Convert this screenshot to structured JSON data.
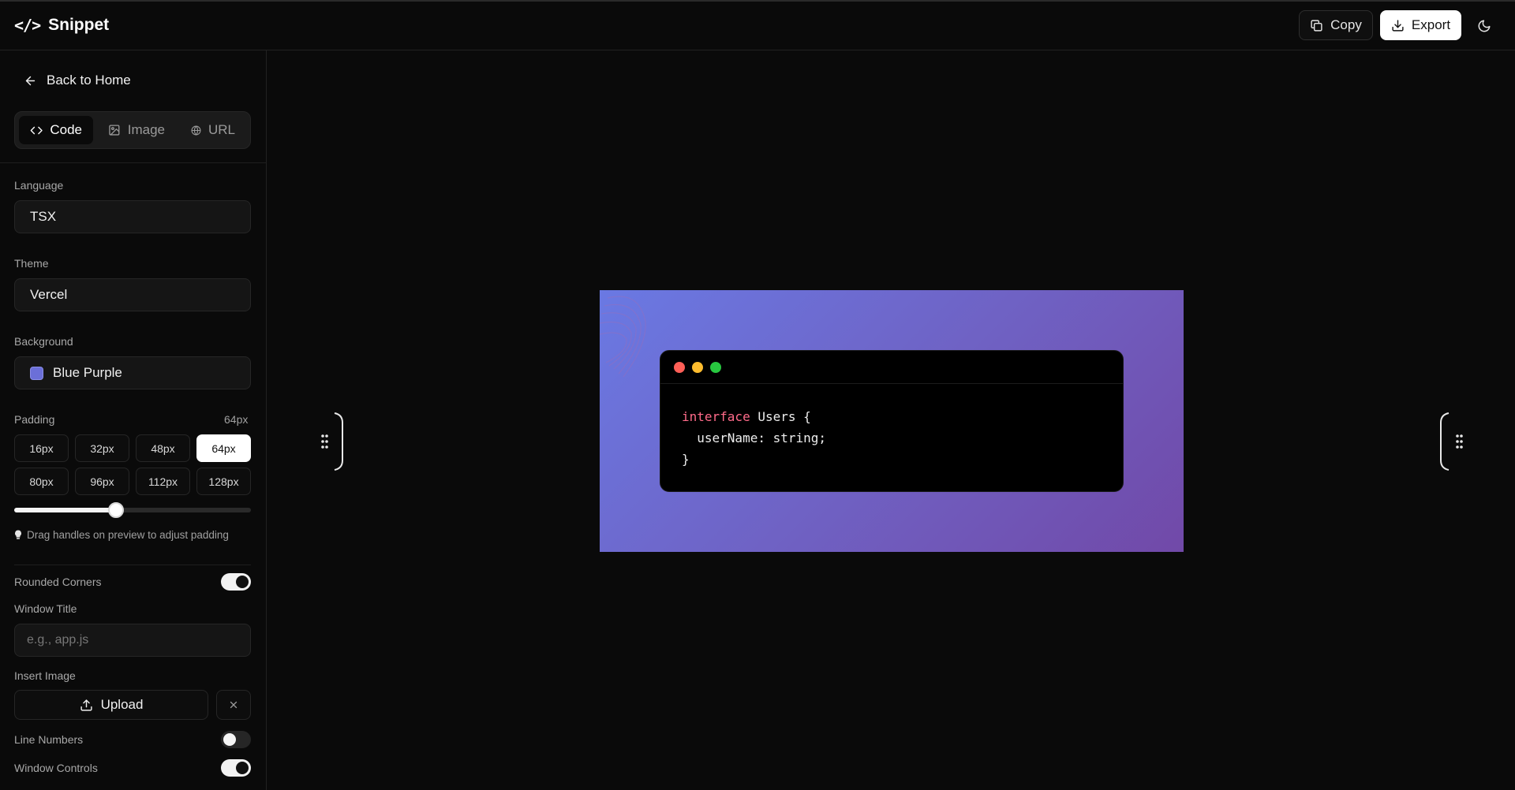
{
  "app": {
    "title": "Snippet",
    "brand_glyph": "</>"
  },
  "header": {
    "copy_label": "Copy",
    "export_label": "Export",
    "theme_icon": "moon-icon"
  },
  "sidebar": {
    "back_label": "Back to Home",
    "tabs": [
      {
        "label": "Code",
        "icon": "code-icon",
        "active": true
      },
      {
        "label": "Image",
        "icon": "image-icon",
        "active": false
      },
      {
        "label": "URL",
        "icon": "globe-icon",
        "active": false
      }
    ],
    "language": {
      "label": "Language",
      "value": "TSX"
    },
    "theme": {
      "label": "Theme",
      "value": "Vercel"
    },
    "background": {
      "label": "Background",
      "value": "Blue Purple",
      "swatch_color": "#6b6fd8"
    },
    "padding": {
      "label": "Padding",
      "value": "64px",
      "options": [
        "16px",
        "32px",
        "48px",
        "64px",
        "80px",
        "96px",
        "112px",
        "128px"
      ],
      "selected": "64px",
      "slider_fraction": 0.43,
      "hint": "Drag handles on preview to adjust padding"
    },
    "rounded_corners": {
      "label": "Rounded Corners",
      "on": true
    },
    "window_title": {
      "label": "Window Title",
      "placeholder": "e.g., app.js",
      "value": ""
    },
    "insert_image": {
      "label": "Insert Image",
      "upload_label": "Upload"
    },
    "line_numbers": {
      "label": "Line Numbers",
      "on": false
    },
    "window_controls": {
      "label": "Window Controls",
      "on": true
    }
  },
  "preview": {
    "gradient": [
      "#6a79e3",
      "#6f62c4",
      "#7149a8"
    ],
    "window_dots": [
      "#ff5f57",
      "#febc2e",
      "#28c840"
    ],
    "code": {
      "line1_keyword": "interface",
      "line1_rest": " Users {",
      "line2": "  userName: string;",
      "line3": "}"
    }
  }
}
